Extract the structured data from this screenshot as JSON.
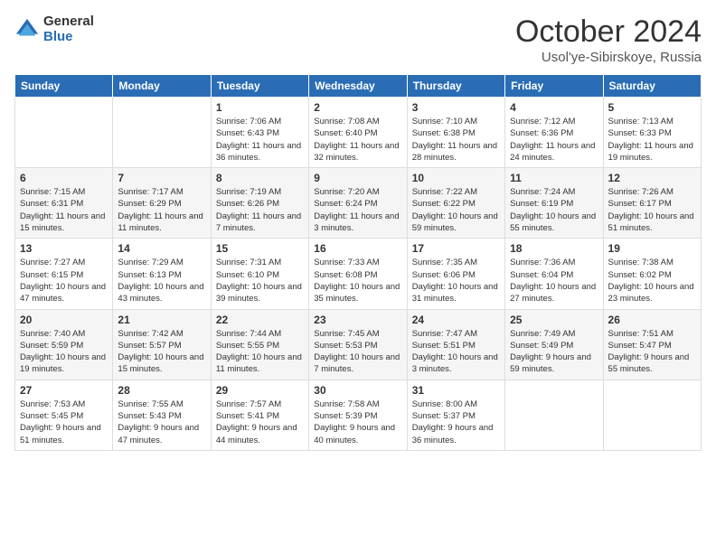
{
  "header": {
    "logo_general": "General",
    "logo_blue": "Blue",
    "month_title": "October 2024",
    "location": "Usol'ye-Sibirskoye, Russia"
  },
  "weekdays": [
    "Sunday",
    "Monday",
    "Tuesday",
    "Wednesday",
    "Thursday",
    "Friday",
    "Saturday"
  ],
  "weeks": [
    [
      {
        "day": null,
        "sunrise": null,
        "sunset": null,
        "daylight": null
      },
      {
        "day": null,
        "sunrise": null,
        "sunset": null,
        "daylight": null
      },
      {
        "day": "1",
        "sunrise": "Sunrise: 7:06 AM",
        "sunset": "Sunset: 6:43 PM",
        "daylight": "Daylight: 11 hours and 36 minutes."
      },
      {
        "day": "2",
        "sunrise": "Sunrise: 7:08 AM",
        "sunset": "Sunset: 6:40 PM",
        "daylight": "Daylight: 11 hours and 32 minutes."
      },
      {
        "day": "3",
        "sunrise": "Sunrise: 7:10 AM",
        "sunset": "Sunset: 6:38 PM",
        "daylight": "Daylight: 11 hours and 28 minutes."
      },
      {
        "day": "4",
        "sunrise": "Sunrise: 7:12 AM",
        "sunset": "Sunset: 6:36 PM",
        "daylight": "Daylight: 11 hours and 24 minutes."
      },
      {
        "day": "5",
        "sunrise": "Sunrise: 7:13 AM",
        "sunset": "Sunset: 6:33 PM",
        "daylight": "Daylight: 11 hours and 19 minutes."
      }
    ],
    [
      {
        "day": "6",
        "sunrise": "Sunrise: 7:15 AM",
        "sunset": "Sunset: 6:31 PM",
        "daylight": "Daylight: 11 hours and 15 minutes."
      },
      {
        "day": "7",
        "sunrise": "Sunrise: 7:17 AM",
        "sunset": "Sunset: 6:29 PM",
        "daylight": "Daylight: 11 hours and 11 minutes."
      },
      {
        "day": "8",
        "sunrise": "Sunrise: 7:19 AM",
        "sunset": "Sunset: 6:26 PM",
        "daylight": "Daylight: 11 hours and 7 minutes."
      },
      {
        "day": "9",
        "sunrise": "Sunrise: 7:20 AM",
        "sunset": "Sunset: 6:24 PM",
        "daylight": "Daylight: 11 hours and 3 minutes."
      },
      {
        "day": "10",
        "sunrise": "Sunrise: 7:22 AM",
        "sunset": "Sunset: 6:22 PM",
        "daylight": "Daylight: 10 hours and 59 minutes."
      },
      {
        "day": "11",
        "sunrise": "Sunrise: 7:24 AM",
        "sunset": "Sunset: 6:19 PM",
        "daylight": "Daylight: 10 hours and 55 minutes."
      },
      {
        "day": "12",
        "sunrise": "Sunrise: 7:26 AM",
        "sunset": "Sunset: 6:17 PM",
        "daylight": "Daylight: 10 hours and 51 minutes."
      }
    ],
    [
      {
        "day": "13",
        "sunrise": "Sunrise: 7:27 AM",
        "sunset": "Sunset: 6:15 PM",
        "daylight": "Daylight: 10 hours and 47 minutes."
      },
      {
        "day": "14",
        "sunrise": "Sunrise: 7:29 AM",
        "sunset": "Sunset: 6:13 PM",
        "daylight": "Daylight: 10 hours and 43 minutes."
      },
      {
        "day": "15",
        "sunrise": "Sunrise: 7:31 AM",
        "sunset": "Sunset: 6:10 PM",
        "daylight": "Daylight: 10 hours and 39 minutes."
      },
      {
        "day": "16",
        "sunrise": "Sunrise: 7:33 AM",
        "sunset": "Sunset: 6:08 PM",
        "daylight": "Daylight: 10 hours and 35 minutes."
      },
      {
        "day": "17",
        "sunrise": "Sunrise: 7:35 AM",
        "sunset": "Sunset: 6:06 PM",
        "daylight": "Daylight: 10 hours and 31 minutes."
      },
      {
        "day": "18",
        "sunrise": "Sunrise: 7:36 AM",
        "sunset": "Sunset: 6:04 PM",
        "daylight": "Daylight: 10 hours and 27 minutes."
      },
      {
        "day": "19",
        "sunrise": "Sunrise: 7:38 AM",
        "sunset": "Sunset: 6:02 PM",
        "daylight": "Daylight: 10 hours and 23 minutes."
      }
    ],
    [
      {
        "day": "20",
        "sunrise": "Sunrise: 7:40 AM",
        "sunset": "Sunset: 5:59 PM",
        "daylight": "Daylight: 10 hours and 19 minutes."
      },
      {
        "day": "21",
        "sunrise": "Sunrise: 7:42 AM",
        "sunset": "Sunset: 5:57 PM",
        "daylight": "Daylight: 10 hours and 15 minutes."
      },
      {
        "day": "22",
        "sunrise": "Sunrise: 7:44 AM",
        "sunset": "Sunset: 5:55 PM",
        "daylight": "Daylight: 10 hours and 11 minutes."
      },
      {
        "day": "23",
        "sunrise": "Sunrise: 7:45 AM",
        "sunset": "Sunset: 5:53 PM",
        "daylight": "Daylight: 10 hours and 7 minutes."
      },
      {
        "day": "24",
        "sunrise": "Sunrise: 7:47 AM",
        "sunset": "Sunset: 5:51 PM",
        "daylight": "Daylight: 10 hours and 3 minutes."
      },
      {
        "day": "25",
        "sunrise": "Sunrise: 7:49 AM",
        "sunset": "Sunset: 5:49 PM",
        "daylight": "Daylight: 9 hours and 59 minutes."
      },
      {
        "day": "26",
        "sunrise": "Sunrise: 7:51 AM",
        "sunset": "Sunset: 5:47 PM",
        "daylight": "Daylight: 9 hours and 55 minutes."
      }
    ],
    [
      {
        "day": "27",
        "sunrise": "Sunrise: 7:53 AM",
        "sunset": "Sunset: 5:45 PM",
        "daylight": "Daylight: 9 hours and 51 minutes."
      },
      {
        "day": "28",
        "sunrise": "Sunrise: 7:55 AM",
        "sunset": "Sunset: 5:43 PM",
        "daylight": "Daylight: 9 hours and 47 minutes."
      },
      {
        "day": "29",
        "sunrise": "Sunrise: 7:57 AM",
        "sunset": "Sunset: 5:41 PM",
        "daylight": "Daylight: 9 hours and 44 minutes."
      },
      {
        "day": "30",
        "sunrise": "Sunrise: 7:58 AM",
        "sunset": "Sunset: 5:39 PM",
        "daylight": "Daylight: 9 hours and 40 minutes."
      },
      {
        "day": "31",
        "sunrise": "Sunrise: 8:00 AM",
        "sunset": "Sunset: 5:37 PM",
        "daylight": "Daylight: 9 hours and 36 minutes."
      },
      {
        "day": null,
        "sunrise": null,
        "sunset": null,
        "daylight": null
      },
      {
        "day": null,
        "sunrise": null,
        "sunset": null,
        "daylight": null
      }
    ]
  ]
}
